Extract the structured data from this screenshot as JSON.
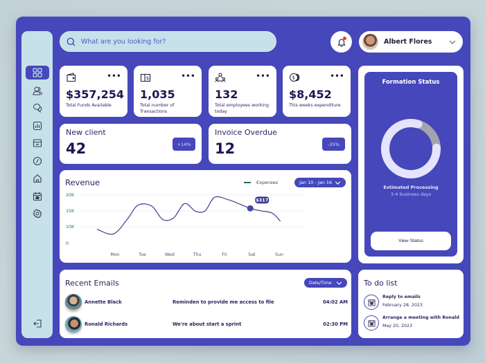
{
  "search": {
    "placeholder": "What are you looking for?"
  },
  "header": {
    "user_name": "Albert Flores",
    "notification_unread": true
  },
  "sidebar": {
    "items": [
      {
        "icon": "grid-icon",
        "label": "Dashboard",
        "active": true
      },
      {
        "icon": "users-icon",
        "label": "Users",
        "active": false
      },
      {
        "icon": "chat-icon",
        "label": "Messages",
        "active": false
      },
      {
        "icon": "chart-icon",
        "label": "Reports",
        "active": false
      },
      {
        "icon": "inbox-icon",
        "label": "Inbox",
        "active": false
      },
      {
        "icon": "clock-icon",
        "label": "History",
        "active": false
      },
      {
        "icon": "home-icon",
        "label": "Home",
        "active": false
      },
      {
        "icon": "calendar-icon",
        "label": "Calendar",
        "active": false
      },
      {
        "icon": "gear-icon",
        "label": "Settings",
        "active": false
      }
    ],
    "logout_icon": "logout-icon"
  },
  "stats": [
    {
      "icon": "wallet-icon",
      "value": "$357,254",
      "label": "Total Funds Available"
    },
    {
      "icon": "ledger-icon",
      "value": "1,035",
      "label": "Total number of Transactions"
    },
    {
      "icon": "employees-icon",
      "value": "132",
      "label": "Total employees working today"
    },
    {
      "icon": "coins-icon",
      "value": "$8,452",
      "label": "This weeks expenditure"
    }
  ],
  "kpis": [
    {
      "title": "New client",
      "value": "42",
      "change": "+14%"
    },
    {
      "title": "Invoice Overdue",
      "value": "12",
      "change": "-25%"
    }
  ],
  "revenue": {
    "title": "Revenue",
    "legend": "Expenses",
    "date_range": "Jan 10 - Jan 16",
    "tooltip": "$317"
  },
  "chart_data": {
    "type": "line",
    "title": "Revenue",
    "legend": [
      "Expenses"
    ],
    "x": [
      "Mon",
      "Tue",
      "Wed",
      "Thu",
      "Fri",
      "Sat",
      "Sun"
    ],
    "yticks": [
      "0",
      "10K",
      "15K",
      "20K"
    ],
    "ylim": [
      0,
      20000
    ],
    "series": [
      {
        "name": "Expenses",
        "points": [
          [
            0,
            8500
          ],
          [
            0.6,
            5700
          ],
          [
            1.1,
            12300
          ],
          [
            1.5,
            16800
          ],
          [
            2.0,
            16500
          ],
          [
            2.4,
            12300
          ],
          [
            2.8,
            12800
          ],
          [
            3.2,
            17300
          ],
          [
            3.6,
            14900
          ],
          [
            3.95,
            15000
          ],
          [
            4.3,
            19300
          ],
          [
            4.8,
            18500
          ],
          [
            5.2,
            17200
          ],
          [
            5.6,
            15800
          ],
          [
            6.0,
            15000
          ],
          [
            6.4,
            14300
          ],
          [
            6.7,
            11800
          ]
        ]
      }
    ],
    "highlight": {
      "x": 5.6,
      "y": 15800,
      "label": "$317"
    },
    "grid": true
  },
  "formation": {
    "title": "Formation Status",
    "progress_pct": 80,
    "estimate_label": "Estimated Processing",
    "estimate_value": "3-4 business days",
    "button": "View Status"
  },
  "emails": {
    "title": "Recent Emails",
    "sort_label": "Date/Time",
    "rows": [
      {
        "from": "Annette Black",
        "subject": "Reminden to provide me access to file",
        "time": "04:02 AM"
      },
      {
        "from": "Ronald Richards",
        "subject": "We're about start a sprint",
        "time": "02:30 PM"
      }
    ]
  },
  "todo": {
    "title": "To do list",
    "items": [
      {
        "title": "Reply to emails",
        "date": "February 28, 2023"
      },
      {
        "title": "Arrange a meeting with Ronald",
        "date": "May 20, 2023"
      }
    ]
  }
}
